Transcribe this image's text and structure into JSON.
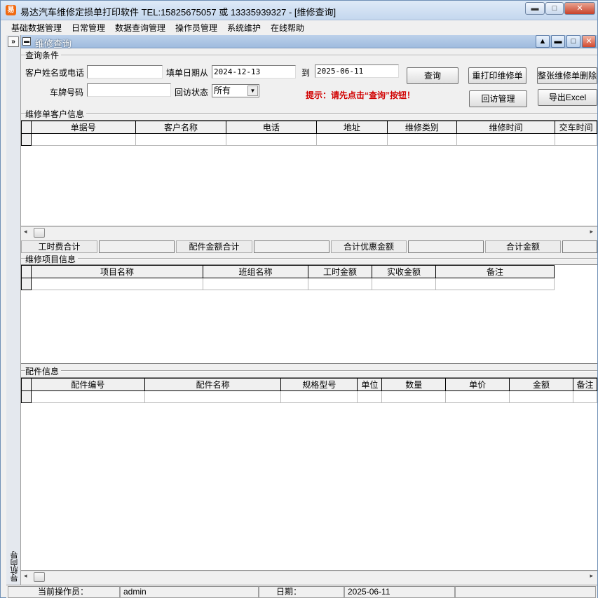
{
  "window": {
    "title": "易达汽车维修定损单打印软件  TEL:15825675057 或 13335939327  - [维修查询]",
    "min": "▬",
    "max": "□",
    "close": "✕"
  },
  "menu": [
    "基础数据管理",
    "日常管理",
    "数据查询管理",
    "操作员管理",
    "系统维护",
    "在线帮助"
  ],
  "left_strip": {
    "toggle": "»",
    "label": "导航向导"
  },
  "child": {
    "title": "维修查询",
    "icon": "▬",
    "min": "▬",
    "max": "□",
    "close": "✕",
    "restore": "▲"
  },
  "query": {
    "section": "查询条件",
    "customer_label": "客户姓名或电话",
    "customer_value": "",
    "date_from_label": "填单日期从",
    "date_from": "2024-12-13",
    "date_to_label": "到",
    "date_to": "2025-06-11",
    "plate_label": "车牌号码",
    "plate_value": "",
    "visit_label": "回访状态",
    "visit_value": "所有",
    "hint": "提示：请先点击“查询”按钮！",
    "buttons": {
      "query": "查询",
      "reprint": "重打印维修单",
      "delete": "整张维修单删除",
      "visit": "回访管理",
      "export": "导出Excel"
    }
  },
  "orders": {
    "section": "维修单客户信息",
    "columns": [
      "单据号",
      "客户名称",
      "电话",
      "地址",
      "维修类别",
      "维修时间",
      "交车时间"
    ]
  },
  "totals": {
    "labor": "工时费合计",
    "parts": "配件金额合计",
    "discount": "合计优惠金额",
    "total": "合计金额"
  },
  "items": {
    "section": "维修项目信息",
    "columns": [
      "项目名称",
      "班组名称",
      "工时金额",
      "实收金额",
      "备注"
    ]
  },
  "parts": {
    "section": "配件信息",
    "columns": [
      "配件编号",
      "配件名称",
      "规格型号",
      "单位",
      "数量",
      "单价",
      "金额",
      "备注"
    ]
  },
  "scroll": {
    "left": "◂",
    "right": "▸"
  },
  "status": {
    "operator_label": "当前操作员：",
    "operator": "admin",
    "date_label": "日期：",
    "date": "2025-06-11"
  }
}
